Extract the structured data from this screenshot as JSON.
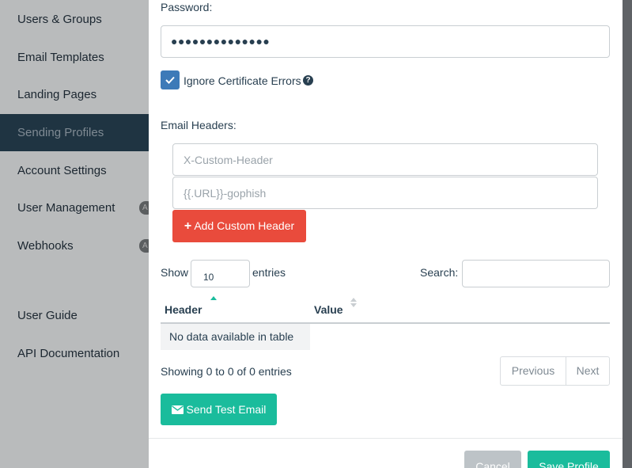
{
  "sidebar": {
    "items": [
      {
        "label": "Users & Groups"
      },
      {
        "label": "Email Templates"
      },
      {
        "label": "Landing Pages"
      },
      {
        "label": "Sending Profiles"
      },
      {
        "label": "Account Settings"
      },
      {
        "label": "User Management",
        "badge": "A"
      },
      {
        "label": "Webhooks",
        "badge": "A"
      },
      {
        "label": "User Guide"
      },
      {
        "label": "API Documentation"
      }
    ]
  },
  "form": {
    "password_label": "Password:",
    "password_value": "●●●●●●●●●●●●●●",
    "ignore_cert_label": "Ignore Certificate Errors",
    "ignore_cert_checked": true,
    "email_headers_label": "Email Headers:",
    "header_placeholder": "X-Custom-Header",
    "value_placeholder": "{{.URL}}-gophish",
    "add_header_button": "Add Custom Header"
  },
  "table": {
    "show_label": "Show",
    "entries_value": "10",
    "entries_label": "entries",
    "search_label": "Search:",
    "search_value": "",
    "columns": [
      "Header",
      "Value"
    ],
    "empty_message": "No data available in table",
    "info": "Showing 0 to 0 of 0 entries",
    "previous": "Previous",
    "next": "Next"
  },
  "actions": {
    "send_test": "Send Test Email",
    "cancel": "Cancel",
    "save": "Save Profile"
  },
  "colors": {
    "accent_green": "#1abc9c",
    "danger_red": "#e94b3c",
    "checkbox_blue": "#3d7ab8",
    "sidebar_active": "#1f3442"
  }
}
